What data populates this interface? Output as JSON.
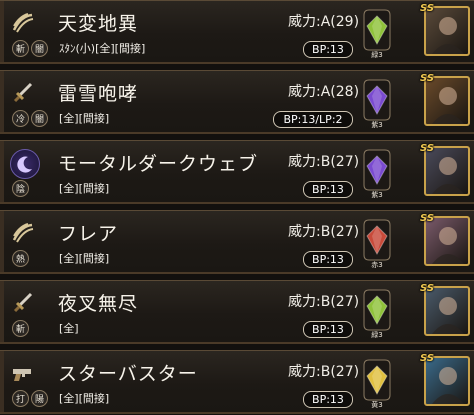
{
  "skills": [
    {
      "name": "天変地異",
      "power": "威力:A(29)",
      "icons": [
        "斬",
        "闇"
      ],
      "tags": "ｽﾀﾝ(小)[全][間接]",
      "bp": "BP:13",
      "gem_label": "緑3",
      "gem_color": "#8fc23a",
      "main_icon": "claw-icon",
      "portrait": "#5a4a3a"
    },
    {
      "name": "雷雪咆哮",
      "power": "威力:A(28)",
      "icons": [
        "冷",
        "闇"
      ],
      "tags": "[全][間接]",
      "bp": "BP:13/LP:2",
      "gem_label": "紫3",
      "gem_color": "#7a4ad0",
      "main_icon": "sword-icon",
      "portrait": "#6a4a2a"
    },
    {
      "name": "モータルダークウェブ",
      "power": "威力:B(27)",
      "icons": [
        "陰"
      ],
      "tags": "[全][間接]",
      "bp": "BP:13",
      "gem_label": "紫3",
      "gem_color": "#7a4ad0",
      "main_icon": "moon-icon",
      "portrait": "#4a4a5a"
    },
    {
      "name": "フレア",
      "power": "威力:B(27)",
      "icons": [
        "熱"
      ],
      "tags": "[全][間接]",
      "bp": "BP:13",
      "gem_label": "赤3",
      "gem_color": "#c84a3a",
      "main_icon": "claw-icon",
      "portrait": "#7a5a6a"
    },
    {
      "name": "夜叉無尽",
      "power": "威力:B(27)",
      "icons": [
        "斬"
      ],
      "tags": "[全]",
      "bp": "BP:13",
      "gem_label": "緑3",
      "gem_color": "#8fc23a",
      "main_icon": "sword-icon",
      "portrait": "#4a5a6a"
    },
    {
      "name": "スターバスター",
      "power": "威力:B(27)",
      "icons": [
        "打",
        "陽"
      ],
      "tags": "[全][間接]",
      "bp": "BP:13",
      "gem_label": "黄3",
      "gem_color": "#e0c040",
      "main_icon": "gun-icon",
      "portrait": "#3a6a8a"
    }
  ],
  "badge": "SS"
}
